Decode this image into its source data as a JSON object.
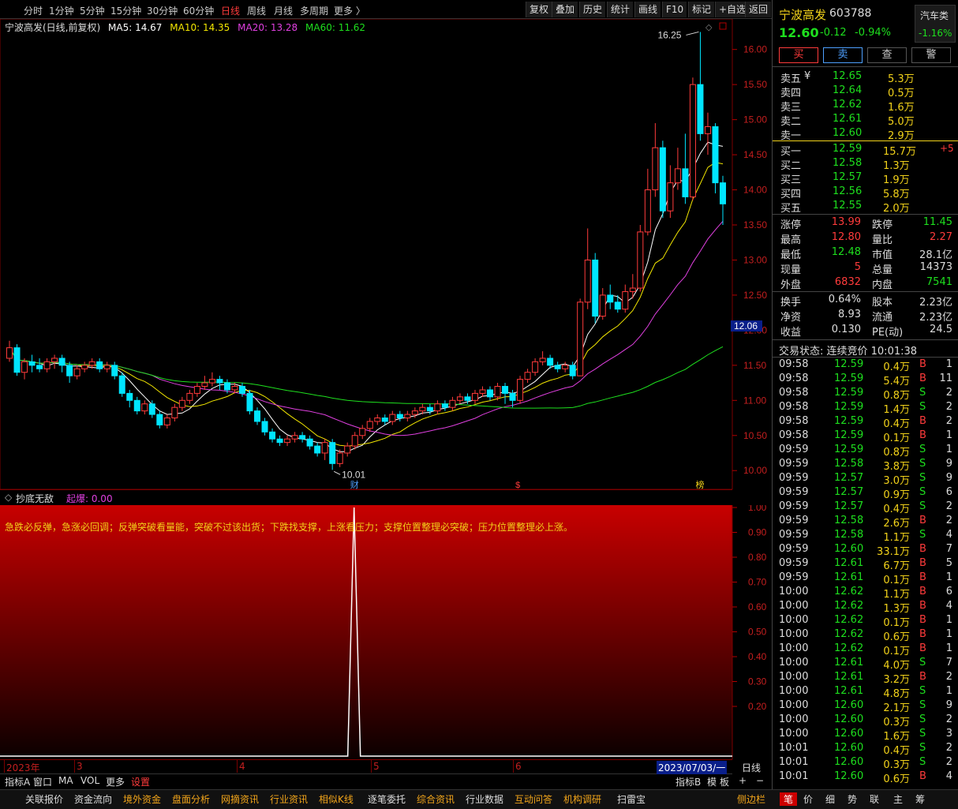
{
  "toolbar": {
    "periods": [
      "分时",
      "1分钟",
      "5分钟",
      "15分钟",
      "30分钟",
      "60分钟",
      "日线",
      "周线",
      "月线",
      "多周期",
      "更多 〉"
    ],
    "active_period": "日线",
    "right_buttons": [
      "复权",
      "叠加",
      "历史",
      "统计",
      "画线",
      "F10",
      "标记",
      "+自选",
      "返回"
    ]
  },
  "chart_legend": {
    "title": "宁波高发(日线,前复权)",
    "ma5": "MA5: 14.67",
    "ma10": "MA10: 14.35",
    "ma20": "MA20: 13.28",
    "ma60": "MA60: 11.62"
  },
  "chart_data": {
    "type": "candlestick",
    "ylim": [
      9.8,
      16.3
    ],
    "y_ticks": [
      "16.00",
      "15.50",
      "15.00",
      "14.50",
      "14.00",
      "13.50",
      "13.00",
      "12.50",
      "12.00",
      "11.50",
      "11.00",
      "10.50",
      "10.00"
    ],
    "y_tick_values": [
      16.0,
      15.5,
      15.0,
      14.5,
      14.0,
      13.5,
      13.0,
      12.5,
      12.0,
      11.5,
      11.0,
      10.5,
      10.0
    ],
    "current_price_label": "12.06",
    "current_price": 12.06,
    "annotations": {
      "high": "16.25",
      "low": "10.01"
    },
    "x_month_labels": [
      "2023年",
      "3",
      "4",
      "5",
      "6"
    ],
    "cursor_date": "2023/07/03/一",
    "event_markers": [
      "财",
      "$",
      "榜"
    ],
    "candles": [
      [
        11.6,
        11.75,
        11.85,
        11.55
      ],
      [
        11.75,
        11.4,
        11.8,
        11.35
      ],
      [
        11.4,
        11.55,
        11.6,
        11.3
      ],
      [
        11.55,
        11.5,
        11.65,
        11.4
      ],
      [
        11.5,
        11.45,
        11.6,
        11.4
      ],
      [
        11.45,
        11.55,
        11.6,
        11.4
      ],
      [
        11.55,
        11.6,
        11.65,
        11.45
      ],
      [
        11.6,
        11.5,
        11.65,
        11.4
      ],
      [
        11.5,
        11.35,
        11.55,
        11.25
      ],
      [
        11.35,
        11.45,
        11.5,
        11.3
      ],
      [
        11.45,
        11.5,
        11.55,
        11.4
      ],
      [
        11.5,
        11.55,
        11.6,
        11.45
      ],
      [
        11.55,
        11.45,
        11.6,
        11.4
      ],
      [
        11.45,
        11.5,
        11.55,
        11.4
      ],
      [
        11.5,
        11.35,
        11.55,
        11.3
      ],
      [
        11.35,
        11.1,
        11.4,
        11.05
      ],
      [
        11.1,
        11.0,
        11.15,
        10.9
      ],
      [
        11.0,
        10.85,
        11.05,
        10.8
      ],
      [
        10.85,
        10.95,
        11.0,
        10.8
      ],
      [
        10.95,
        10.8,
        11.0,
        10.75
      ],
      [
        10.8,
        10.65,
        10.85,
        10.6
      ],
      [
        10.65,
        10.75,
        10.8,
        10.6
      ],
      [
        10.75,
        10.9,
        10.95,
        10.7
      ],
      [
        10.9,
        11.0,
        11.05,
        10.85
      ],
      [
        11.0,
        11.1,
        11.15,
        10.95
      ],
      [
        11.1,
        11.2,
        11.25,
        11.05
      ],
      [
        11.2,
        11.25,
        11.35,
        11.15
      ],
      [
        11.25,
        11.3,
        11.4,
        11.2
      ],
      [
        11.3,
        11.25,
        11.35,
        11.15
      ],
      [
        11.25,
        11.15,
        11.3,
        11.1
      ],
      [
        11.15,
        11.2,
        11.25,
        11.1
      ],
      [
        11.2,
        11.1,
        11.25,
        11.05
      ],
      [
        11.1,
        10.85,
        11.15,
        10.8
      ],
      [
        10.85,
        10.7,
        10.9,
        10.65
      ],
      [
        10.7,
        10.55,
        10.75,
        10.5
      ],
      [
        10.55,
        10.45,
        10.6,
        10.4
      ],
      [
        10.45,
        10.4,
        10.5,
        10.35
      ],
      [
        10.4,
        10.45,
        10.5,
        10.35
      ],
      [
        10.45,
        10.5,
        10.55,
        10.4
      ],
      [
        10.5,
        10.45,
        10.55,
        10.4
      ],
      [
        10.45,
        10.35,
        10.5,
        10.3
      ],
      [
        10.35,
        10.25,
        10.4,
        10.2
      ],
      [
        10.25,
        10.4,
        10.45,
        10.15
      ],
      [
        10.4,
        10.1,
        10.45,
        10.01
      ],
      [
        10.1,
        10.25,
        10.3,
        10.05
      ],
      [
        10.25,
        10.35,
        10.4,
        10.2
      ],
      [
        10.35,
        10.5,
        10.55,
        10.3
      ],
      [
        10.5,
        10.6,
        10.65,
        10.45
      ],
      [
        10.6,
        10.7,
        10.75,
        10.55
      ],
      [
        10.7,
        10.75,
        10.8,
        10.65
      ],
      [
        10.75,
        10.7,
        10.8,
        10.65
      ],
      [
        10.7,
        10.8,
        10.85,
        10.65
      ],
      [
        10.8,
        10.75,
        10.85,
        10.7
      ],
      [
        10.75,
        10.8,
        10.85,
        10.7
      ],
      [
        10.8,
        10.85,
        10.9,
        10.75
      ],
      [
        10.85,
        10.9,
        10.95,
        10.8
      ],
      [
        10.9,
        10.85,
        10.95,
        10.8
      ],
      [
        10.85,
        10.95,
        11.0,
        10.8
      ],
      [
        10.95,
        10.9,
        11.0,
        10.85
      ],
      [
        10.9,
        11.0,
        11.05,
        10.85
      ],
      [
        11.0,
        11.05,
        11.1,
        10.95
      ],
      [
        11.05,
        11.0,
        11.1,
        10.95
      ],
      [
        11.0,
        11.1,
        11.15,
        10.95
      ],
      [
        11.1,
        11.15,
        11.2,
        11.05
      ],
      [
        11.15,
        11.05,
        11.2,
        11.0
      ],
      [
        11.05,
        11.2,
        11.25,
        11.0
      ],
      [
        11.2,
        11.1,
        11.25,
        10.95
      ],
      [
        11.1,
        11.0,
        11.15,
        10.9
      ],
      [
        11.0,
        11.3,
        11.35,
        10.95
      ],
      [
        11.3,
        11.4,
        11.45,
        11.25
      ],
      [
        11.4,
        11.55,
        11.6,
        11.35
      ],
      [
        11.55,
        11.6,
        11.7,
        11.5
      ],
      [
        11.6,
        11.5,
        11.65,
        11.45
      ],
      [
        11.5,
        11.45,
        11.55,
        11.4
      ],
      [
        11.45,
        11.5,
        11.55,
        11.4
      ],
      [
        11.5,
        11.35,
        11.55,
        11.3
      ],
      [
        11.35,
        12.4,
        12.45,
        11.35
      ],
      [
        12.4,
        13.0,
        13.45,
        12.3
      ],
      [
        13.0,
        12.2,
        13.1,
        12.1
      ],
      [
        12.2,
        12.5,
        12.6,
        12.15
      ],
      [
        12.5,
        12.4,
        12.65,
        12.3
      ],
      [
        12.4,
        12.3,
        12.5,
        12.25
      ],
      [
        12.3,
        12.55,
        12.65,
        12.25
      ],
      [
        12.55,
        12.6,
        12.8,
        12.45
      ],
      [
        12.6,
        13.4,
        13.5,
        12.55
      ],
      [
        13.4,
        14.0,
        14.3,
        13.35
      ],
      [
        14.0,
        14.6,
        14.95,
        13.9
      ],
      [
        14.6,
        13.7,
        14.7,
        13.6
      ],
      [
        13.7,
        14.1,
        14.35,
        13.6
      ],
      [
        14.1,
        14.3,
        14.6,
        14.0
      ],
      [
        14.3,
        13.9,
        14.8,
        13.8
      ],
      [
        13.9,
        15.5,
        15.6,
        13.85
      ],
      [
        15.5,
        14.8,
        16.25,
        14.7
      ],
      [
        14.8,
        14.9,
        15.1,
        14.5
      ],
      [
        14.9,
        14.1,
        14.95,
        13.95
      ],
      [
        14.1,
        13.8,
        14.2,
        13.5
      ]
    ],
    "series": [
      {
        "name": "MA5",
        "color": "#ffffff"
      },
      {
        "name": "MA10",
        "color": "#f2e600"
      },
      {
        "name": "MA20",
        "color": "#e040e0"
      },
      {
        "name": "MA60",
        "color": "#1edf1e"
      }
    ]
  },
  "indicator": {
    "name": "抄底无敌",
    "signal_label": "起爆: 0.00",
    "description": "急跌必反弹，急涨必回调；反弹突破看量能，突破不过该出货；下跌找支撑，上涨看压力；支撑位置整理必突破；压力位置整理必上涨。",
    "y_ticks": [
      "1.00",
      "0.90",
      "0.80",
      "0.70",
      "0.60",
      "0.50",
      "0.40",
      "0.30",
      "0.20"
    ],
    "y_tick_values": [
      1.0,
      0.9,
      0.8,
      0.7,
      0.6,
      0.5,
      0.4,
      0.3,
      0.2
    ],
    "spike_index": 44,
    "spike_value": 1.0
  },
  "indicator_tabs": [
    "指标A",
    "窗口",
    "MA",
    "VOL",
    "更多",
    "设置"
  ],
  "indicator_tabs_right": [
    "指标B",
    "模",
    "板",
    "+",
    "−"
  ],
  "period_label": "日线",
  "stock": {
    "name": "宁波高发",
    "code": "603788",
    "sector": "汽车类",
    "sector_change": "-1.16%",
    "price": "12.60",
    "change": "-0.12",
    "change_pct": "-0.94%"
  },
  "trade_buttons": [
    "买",
    "卖",
    "查",
    "警"
  ],
  "sell_orders": [
    {
      "label": "卖五",
      "price": "12.65",
      "vol": "5.3万"
    },
    {
      "label": "卖四",
      "price": "12.64",
      "vol": "0.5万"
    },
    {
      "label": "卖三",
      "price": "12.62",
      "vol": "1.6万"
    },
    {
      "label": "卖二",
      "price": "12.61",
      "vol": "5.0万"
    },
    {
      "label": "卖一",
      "price": "12.60",
      "vol": "2.9万"
    }
  ],
  "sell_currency": "¥",
  "buy_orders": [
    {
      "label": "买一",
      "price": "12.59",
      "vol": "15.7万",
      "extra": "+5"
    },
    {
      "label": "买二",
      "price": "12.58",
      "vol": "1.3万",
      "extra": ""
    },
    {
      "label": "买三",
      "price": "12.57",
      "vol": "1.9万",
      "extra": ""
    },
    {
      "label": "买四",
      "price": "12.56",
      "vol": "5.8万",
      "extra": ""
    },
    {
      "label": "买五",
      "price": "12.55",
      "vol": "2.0万",
      "extra": ""
    }
  ],
  "stats": [
    {
      "l1": "涨停",
      "v1": "13.99",
      "c1": "r",
      "l2": "跌停",
      "v2": "11.45",
      "c2": "g"
    },
    {
      "l1": "最高",
      "v1": "12.80",
      "c1": "r",
      "l2": "量比",
      "v2": "2.27",
      "c2": "r"
    },
    {
      "l1": "最低",
      "v1": "12.48",
      "c1": "g",
      "l2": "市值",
      "v2": "28.1亿",
      "c2": "w"
    },
    {
      "l1": "现量",
      "v1": "5",
      "c1": "r",
      "l2": "总量",
      "v2": "14373",
      "c2": "w"
    },
    {
      "l1": "外盘",
      "v1": "6832",
      "c1": "r",
      "l2": "内盘",
      "v2": "7541",
      "c2": "g"
    }
  ],
  "stats2": [
    {
      "l1": "换手",
      "v1": "0.64%",
      "l2": "股本",
      "v2": "2.23亿"
    },
    {
      "l1": "净资",
      "v1": "8.93",
      "l2": "流通",
      "v2": "2.23亿"
    },
    {
      "l1": "收益",
      "v1": "0.130",
      "l2": "PE(动)",
      "v2": "24.5"
    }
  ],
  "trade_status": "交易状态: 连续竞价 10:01:38",
  "ticks": [
    [
      "09:58",
      "12.59",
      "0.4万",
      "B",
      "1"
    ],
    [
      "09:58",
      "12.59",
      "5.4万",
      "B",
      "11"
    ],
    [
      "09:58",
      "12.59",
      "0.8万",
      "S",
      "2"
    ],
    [
      "09:58",
      "12.59",
      "1.4万",
      "S",
      "2"
    ],
    [
      "09:58",
      "12.59",
      "0.4万",
      "B",
      "2"
    ],
    [
      "09:58",
      "12.59",
      "0.1万",
      "B",
      "1"
    ],
    [
      "09:59",
      "12.59",
      "0.8万",
      "S",
      "1"
    ],
    [
      "09:59",
      "12.58",
      "3.8万",
      "S",
      "9"
    ],
    [
      "09:59",
      "12.57",
      "3.0万",
      "S",
      "9"
    ],
    [
      "09:59",
      "12.57",
      "0.9万",
      "S",
      "6"
    ],
    [
      "09:59",
      "12.57",
      "0.4万",
      "S",
      "2"
    ],
    [
      "09:59",
      "12.58",
      "2.6万",
      "B",
      "2"
    ],
    [
      "09:59",
      "12.58",
      "1.1万",
      "S",
      "4"
    ],
    [
      "09:59",
      "12.60",
      "33.1万",
      "B",
      "7"
    ],
    [
      "09:59",
      "12.61",
      "6.7万",
      "B",
      "5"
    ],
    [
      "09:59",
      "12.61",
      "0.1万",
      "B",
      "1"
    ],
    [
      "10:00",
      "12.62",
      "1.1万",
      "B",
      "6"
    ],
    [
      "10:00",
      "12.62",
      "1.3万",
      "B",
      "4"
    ],
    [
      "10:00",
      "12.62",
      "0.1万",
      "B",
      "1"
    ],
    [
      "10:00",
      "12.62",
      "0.6万",
      "B",
      "1"
    ],
    [
      "10:00",
      "12.62",
      "0.1万",
      "B",
      "1"
    ],
    [
      "10:00",
      "12.61",
      "4.0万",
      "S",
      "7"
    ],
    [
      "10:00",
      "12.61",
      "3.2万",
      "B",
      "2"
    ],
    [
      "10:00",
      "12.61",
      "4.8万",
      "S",
      "1"
    ],
    [
      "10:00",
      "12.60",
      "2.1万",
      "S",
      "9"
    ],
    [
      "10:00",
      "12.60",
      "0.3万",
      "S",
      "2"
    ],
    [
      "10:00",
      "12.60",
      "1.6万",
      "S",
      "3"
    ],
    [
      "10:01",
      "12.60",
      "0.4万",
      "S",
      "2"
    ],
    [
      "10:01",
      "12.60",
      "0.3万",
      "S",
      "2"
    ],
    [
      "10:01",
      "12.60",
      "0.6万",
      "B",
      "4"
    ]
  ],
  "bottom_tabs": [
    "关联报价",
    "资金流向",
    "境外资金",
    "盘面分析",
    "网摘资讯",
    "行业资讯",
    "相似K线",
    "逐笔委托",
    "综合资讯",
    "行业数据",
    "互动问答",
    "机构调研",
    "扫雷宝"
  ],
  "bottom_right": [
    "侧边栏",
    "笔",
    "价",
    "细",
    "势",
    "联",
    "主",
    "筹"
  ]
}
